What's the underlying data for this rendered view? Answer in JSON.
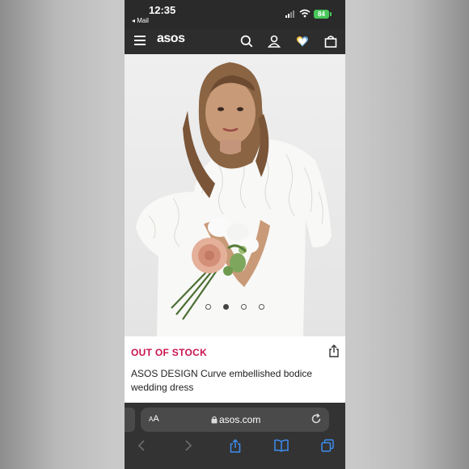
{
  "status_bar": {
    "time": "12:35",
    "back_app": "◂ Mail",
    "battery": "84"
  },
  "nav": {
    "logo": "asos"
  },
  "product": {
    "stock_status": "OUT OF STOCK",
    "title": "ASOS DESIGN Curve embellished bodice wedding dress",
    "image_count": 4,
    "active_image": 2
  },
  "browser": {
    "text_size_label": "AA",
    "url": "asos.com"
  },
  "icons": [
    "hamburger-icon",
    "search-icon",
    "account-icon",
    "saved-heart-icon",
    "bag-icon",
    "share-icon",
    "lock-icon",
    "reload-icon",
    "back-arrow-icon",
    "forward-arrow-icon",
    "browser-share-icon",
    "bookmarks-icon",
    "tabs-icon"
  ],
  "colors": {
    "accent_out_of_stock": "#c8154d",
    "header": "#2d2d2d",
    "battery": "#48c75b"
  }
}
